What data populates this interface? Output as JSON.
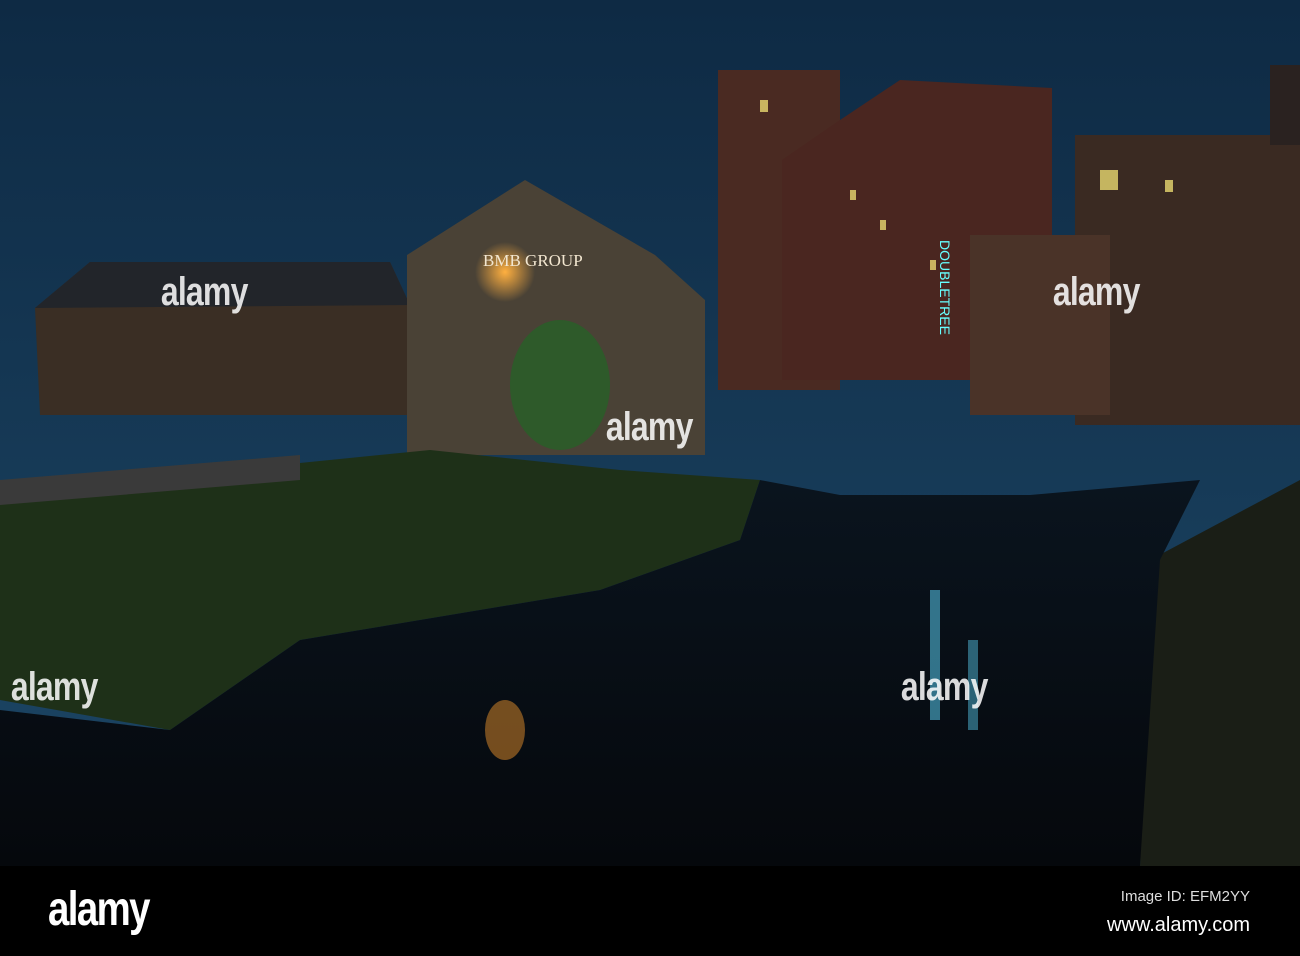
{
  "photo": {
    "description_signs": {
      "warehouse_sign": "BMB GROUP",
      "hotel_sign": "DOUBLETREE"
    },
    "watermark_text": "alamy"
  },
  "footer": {
    "logo": "alamy",
    "image_id": "Image ID: EFM2YY",
    "url": "www.alamy.com"
  }
}
